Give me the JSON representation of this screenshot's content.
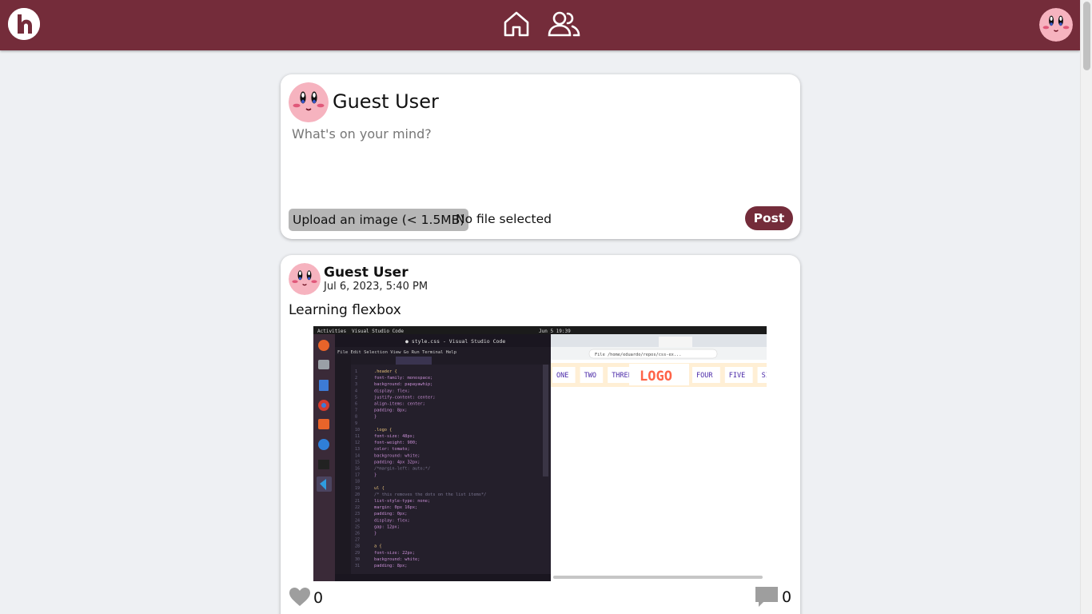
{
  "nav": {
    "logo_icon": "h-logo-icon",
    "home_icon": "home-icon",
    "friends_icon": "users-icon",
    "profile_icon": "avatar"
  },
  "composer": {
    "user_name": "Guest User",
    "placeholder": "What's on your mind?",
    "upload_label": "Upload an image (< 1.5MB)",
    "file_status": "No file selected",
    "post_label": "Post"
  },
  "post": {
    "author": "Guest User",
    "date": "Jul 6, 2023, 5:40 PM",
    "text": "Learning flexbox",
    "likes": "0",
    "comments": "0",
    "screenshot": {
      "topbar_left": "Activities",
      "topbar_app": "Visual Studio Code",
      "topbar_clock": "Jun 5  19:39",
      "editor_title": "● style.css - Visual Studio Code",
      "editor_menu": [
        "File",
        "Edit",
        "Selection",
        "View",
        "Go",
        "Run",
        "Terminal",
        "Help"
      ],
      "browser_url": "File  /home/eduardo/repos/css-ex...",
      "demo_items_left": [
        "ONE",
        "TWO",
        "THREE"
      ],
      "demo_logo": "LOGO",
      "demo_items_right": [
        "FOUR",
        "FIVE",
        "SIX"
      ],
      "code_lines": [
        ".header {",
        "  font-family: monospace;",
        "  background: papayawhip;",
        "  display: flex;",
        "  justify-content: center;",
        "  align-items: center;",
        "  padding: 8px;",
        "}",
        "",
        ".logo {",
        "  font-size: 48px;",
        "  font-weight: 900;",
        "  color: tomato;",
        "  background: white;",
        "  padding: 4px 32px;",
        "  /*margin-left: auto;*/",
        "}",
        "",
        "ul {",
        "  /* this removes the dots on the list items*/",
        "  list-style-type: none;",
        "  margin: 0px 16px;",
        "  padding: 0px;",
        "  display: flex;",
        "  gap: 12px;",
        "}",
        "",
        "a {",
        "  font-size: 22px;",
        "  background: white;",
        "  padding: 8px;"
      ]
    }
  },
  "colors": {
    "brand": "#742c3a",
    "background": "#eef0f3",
    "upload_bg": "#b6b6b6"
  }
}
